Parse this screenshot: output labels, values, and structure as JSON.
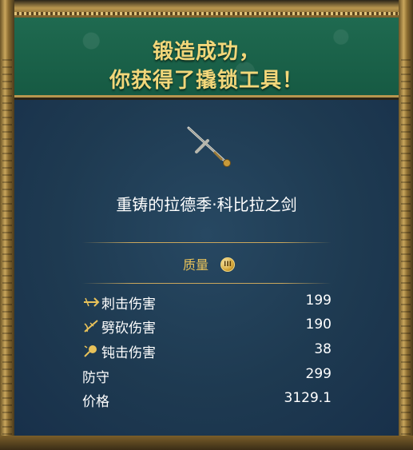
{
  "header": {
    "line1": "锻造成功，",
    "line2": "你获得了撬锁工具！"
  },
  "item": {
    "name": "重铸的拉德季·科比拉之剑",
    "icon": "crossed-sword-icon"
  },
  "quality": {
    "label": "质量",
    "badge": "III",
    "badge_icon": "quality-coin-icon"
  },
  "stats": [
    {
      "icon": "stab-icon",
      "label": "刺击伤害",
      "value": "199"
    },
    {
      "icon": "slash-icon",
      "label": "劈砍伤害",
      "value": "190"
    },
    {
      "icon": "blunt-icon",
      "label": "钝击伤害",
      "value": "38"
    },
    {
      "label": "防守",
      "value": "299"
    },
    {
      "label": "价格",
      "value": "3129.1"
    }
  ],
  "colors": {
    "header_green": "#1f6a50",
    "panel_blue": "#1e3a51",
    "gold": "#e8c25a",
    "title_yellow": "#f2d77a"
  }
}
